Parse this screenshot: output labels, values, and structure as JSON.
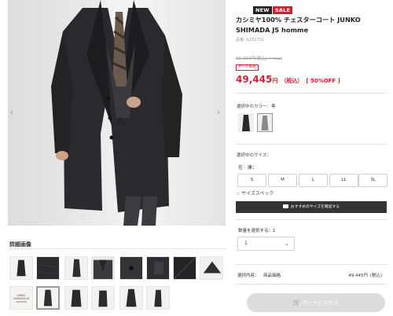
{
  "badges": {
    "new": "NEW",
    "sale": "SALE"
  },
  "product": {
    "title": "カシミヤ100% チェスターコート JUNKO SHIMADA JS homme",
    "sku": "品番: G252701",
    "original_price": "90,000円(税込) 〜mail",
    "sale_tag": "セール価格",
    "price": "49,445",
    "price_unit": "円",
    "tax_note": "（税込）",
    "discount": "[ 50%OFF ]"
  },
  "gallery": {
    "prev_icon": "chevron-left-icon",
    "next_icon": "chevron-right-icon",
    "detail_title": "詳細画像",
    "label_thumb_text": "JUNKO SHIMADA JS homme"
  },
  "color": {
    "label": "選択中のカラー：黒",
    "options": [
      "black",
      "gray"
    ]
  },
  "size": {
    "label": "選択中のサイズ：",
    "stock_heading": "在　庫：",
    "options": [
      "S",
      "M",
      "L",
      "LL",
      "3L"
    ],
    "spec_link": ":: サイズスペック",
    "recommend_label": "おすすめのサイズを確認する"
  },
  "quantity": {
    "label": "数量を選択する：1",
    "value": "1",
    "chevron_icon": "chevron-down-icon"
  },
  "selection": {
    "label": "選択内容：",
    "item": "商品価格",
    "amount": "49,445円",
    "tax": "(税込)"
  },
  "cart": {
    "label": "カートに入れる",
    "icon": "cart-icon"
  },
  "colors": {
    "accent_red": "#cf1f2f",
    "dark": "#333333",
    "disabled": "#dcdcdc"
  }
}
